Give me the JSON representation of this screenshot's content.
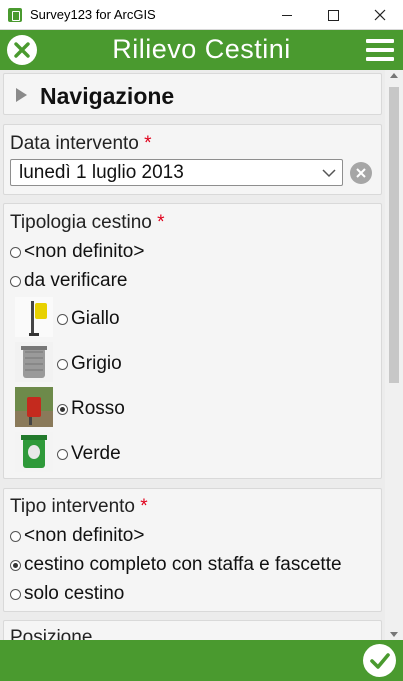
{
  "window": {
    "title": "Survey123 for ArcGIS",
    "minimize_icon": "minimize-icon",
    "maximize_icon": "maximize-icon",
    "close_icon": "close-icon"
  },
  "appbar": {
    "title": "Rilievo Cestini",
    "close_icon": "close-circle-icon",
    "menu_icon": "hamburger-menu-icon",
    "color": "#4a9a2f"
  },
  "form": {
    "navigazione": {
      "label": "Navigazione"
    },
    "data_intervento": {
      "label": "Data intervento",
      "required_mark": "*",
      "value": "lunedì 1 luglio 2013"
    },
    "tipologia_cestino": {
      "label": "Tipologia cestino",
      "required_mark": "*",
      "options": [
        {
          "label": "<non definito>",
          "checked": false
        },
        {
          "label": "da verificare",
          "checked": false
        },
        {
          "label": "Giallo",
          "checked": false,
          "image": "yellow-bin-image"
        },
        {
          "label": "Grigio",
          "checked": false,
          "image": "grey-bin-image"
        },
        {
          "label": "Rosso",
          "checked": true,
          "image": "red-bin-image"
        },
        {
          "label": "Verde",
          "checked": false,
          "image": "green-bin-image"
        }
      ]
    },
    "tipo_intervento": {
      "label": "Tipo intervento",
      "required_mark": "*",
      "options": [
        {
          "label": "<non definito>",
          "checked": false
        },
        {
          "label": "cestino completo con staffa e fascette",
          "checked": true
        },
        {
          "label": "solo cestino",
          "checked": false
        }
      ]
    },
    "posizione": {
      "label": "Posizione"
    }
  },
  "footer": {
    "submit_icon": "checkmark-icon"
  },
  "colors": {
    "required": "#e0001b",
    "accent": "#4a9a2f"
  }
}
